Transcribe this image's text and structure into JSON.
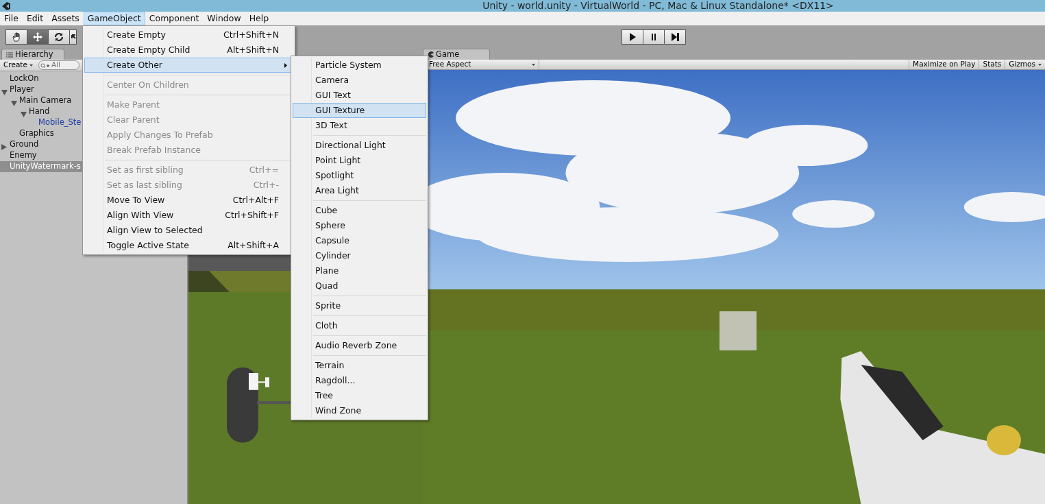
{
  "window": {
    "title": "Unity - world.unity - VirtualWorld - PC, Mac & Linux Standalone* <DX11>"
  },
  "menubar": [
    {
      "label": "File",
      "selected": false
    },
    {
      "label": "Edit",
      "selected": false
    },
    {
      "label": "Assets",
      "selected": false
    },
    {
      "label": "GameObject",
      "selected": true
    },
    {
      "label": "Component",
      "selected": false
    },
    {
      "label": "Window",
      "selected": false
    },
    {
      "label": "Help",
      "selected": false
    }
  ],
  "tools": [
    {
      "kind": "hand",
      "selected": false
    },
    {
      "kind": "move",
      "selected": true
    },
    {
      "kind": "rotate",
      "selected": false
    },
    {
      "kind": "scale",
      "selected": false
    }
  ],
  "playback": [
    {
      "kind": "play"
    },
    {
      "kind": "pause"
    },
    {
      "kind": "step"
    }
  ],
  "hierarchy": {
    "tab": "Hierarchy",
    "create": "Create",
    "search": {
      "placeholder": "All"
    },
    "items": [
      {
        "label": "LockOn",
        "selected": false,
        "prefab": false
      },
      {
        "label": "Player",
        "expanded": true,
        "selected": false,
        "prefab": false,
        "children": [
          {
            "label": "Main Camera",
            "expanded": true,
            "selected": false,
            "prefab": false,
            "children": [
              {
                "label": "Hand",
                "expanded": true,
                "selected": false,
                "prefab": false,
                "children": [
                  {
                    "label": "Mobile_Ste",
                    "selected": false,
                    "prefab": true
                  }
                ]
              }
            ]
          },
          {
            "label": "Graphics",
            "selected": false,
            "prefab": false
          }
        ]
      },
      {
        "label": "Ground",
        "expanded": false,
        "selected": false,
        "prefab": false
      },
      {
        "label": "Enemy",
        "selected": false,
        "prefab": false
      },
      {
        "label": "UnityWatermark-s",
        "selected": true,
        "prefab": false
      }
    ]
  },
  "game": {
    "tab": "Game",
    "aspect": "Free Aspect",
    "toolbar_buttons": [
      {
        "label": "Maximize on Play",
        "dropdown": false
      },
      {
        "label": "Stats",
        "dropdown": false
      },
      {
        "label": "Gizmos",
        "dropdown": true
      }
    ]
  },
  "menu": [
    {
      "kind": "item",
      "label": "Create Empty",
      "shortcut": "Ctrl+Shift+N",
      "disabled": false,
      "selected": false,
      "submenu": false
    },
    {
      "kind": "item",
      "label": "Create Empty Child",
      "shortcut": "Alt+Shift+N",
      "disabled": false,
      "selected": false,
      "submenu": false
    },
    {
      "kind": "item",
      "label": "Create Other",
      "disabled": false,
      "selected": true,
      "submenu": true
    },
    {
      "kind": "separator"
    },
    {
      "kind": "item",
      "label": "Center On Children",
      "disabled": true,
      "selected": false,
      "submenu": false
    },
    {
      "kind": "separator"
    },
    {
      "kind": "item",
      "label": "Make Parent",
      "disabled": true,
      "selected": false,
      "submenu": false
    },
    {
      "kind": "item",
      "label": "Clear Parent",
      "disabled": true,
      "selected": false,
      "submenu": false
    },
    {
      "kind": "item",
      "label": "Apply Changes To Prefab",
      "disabled": true,
      "selected": false,
      "submenu": false
    },
    {
      "kind": "item",
      "label": "Break Prefab Instance",
      "disabled": true,
      "selected": false,
      "submenu": false
    },
    {
      "kind": "separator"
    },
    {
      "kind": "item",
      "label": "Set as first sibling",
      "shortcut": "Ctrl+=",
      "disabled": true,
      "selected": false,
      "submenu": false
    },
    {
      "kind": "item",
      "label": "Set as last sibling",
      "shortcut": "Ctrl+-",
      "disabled": true,
      "selected": false,
      "submenu": false
    },
    {
      "kind": "item",
      "label": "Move To View",
      "shortcut": "Ctrl+Alt+F",
      "disabled": false,
      "selected": false,
      "submenu": false
    },
    {
      "kind": "item",
      "label": "Align With View",
      "shortcut": "Ctrl+Shift+F",
      "disabled": false,
      "selected": false,
      "submenu": false
    },
    {
      "kind": "item",
      "label": "Align View to Selected",
      "disabled": false,
      "selected": false,
      "submenu": false
    },
    {
      "kind": "item",
      "label": "Toggle Active State",
      "shortcut": "Alt+Shift+A",
      "disabled": false,
      "selected": false,
      "submenu": false
    }
  ],
  "submenu": [
    {
      "kind": "item",
      "label": "Particle System",
      "selected": false
    },
    {
      "kind": "item",
      "label": "Camera",
      "selected": false
    },
    {
      "kind": "item",
      "label": "GUI Text",
      "selected": false
    },
    {
      "kind": "item",
      "label": "GUI Texture",
      "selected": true
    },
    {
      "kind": "item",
      "label": "3D Text",
      "selected": false
    },
    {
      "kind": "separator"
    },
    {
      "kind": "item",
      "label": "Directional Light",
      "selected": false
    },
    {
      "kind": "item",
      "label": "Point Light",
      "selected": false
    },
    {
      "kind": "item",
      "label": "Spotlight",
      "selected": false
    },
    {
      "kind": "item",
      "label": "Area Light",
      "selected": false
    },
    {
      "kind": "separator"
    },
    {
      "kind": "item",
      "label": "Cube",
      "selected": false
    },
    {
      "kind": "item",
      "label": "Sphere",
      "selected": false
    },
    {
      "kind": "item",
      "label": "Capsule",
      "selected": false
    },
    {
      "kind": "item",
      "label": "Cylinder",
      "selected": false
    },
    {
      "kind": "item",
      "label": "Plane",
      "selected": false
    },
    {
      "kind": "item",
      "label": "Quad",
      "selected": false
    },
    {
      "kind": "separator"
    },
    {
      "kind": "item",
      "label": "Sprite",
      "selected": false
    },
    {
      "kind": "separator"
    },
    {
      "kind": "item",
      "label": "Cloth",
      "selected": false
    },
    {
      "kind": "separator"
    },
    {
      "kind": "item",
      "label": "Audio Reverb Zone",
      "selected": false
    },
    {
      "kind": "separator"
    },
    {
      "kind": "item",
      "label": "Terrain",
      "selected": false
    },
    {
      "kind": "item",
      "label": "Ragdoll...",
      "selected": false
    },
    {
      "kind": "item",
      "label": "Tree",
      "selected": false
    },
    {
      "kind": "item",
      "label": "Wind Zone",
      "selected": false
    }
  ]
}
